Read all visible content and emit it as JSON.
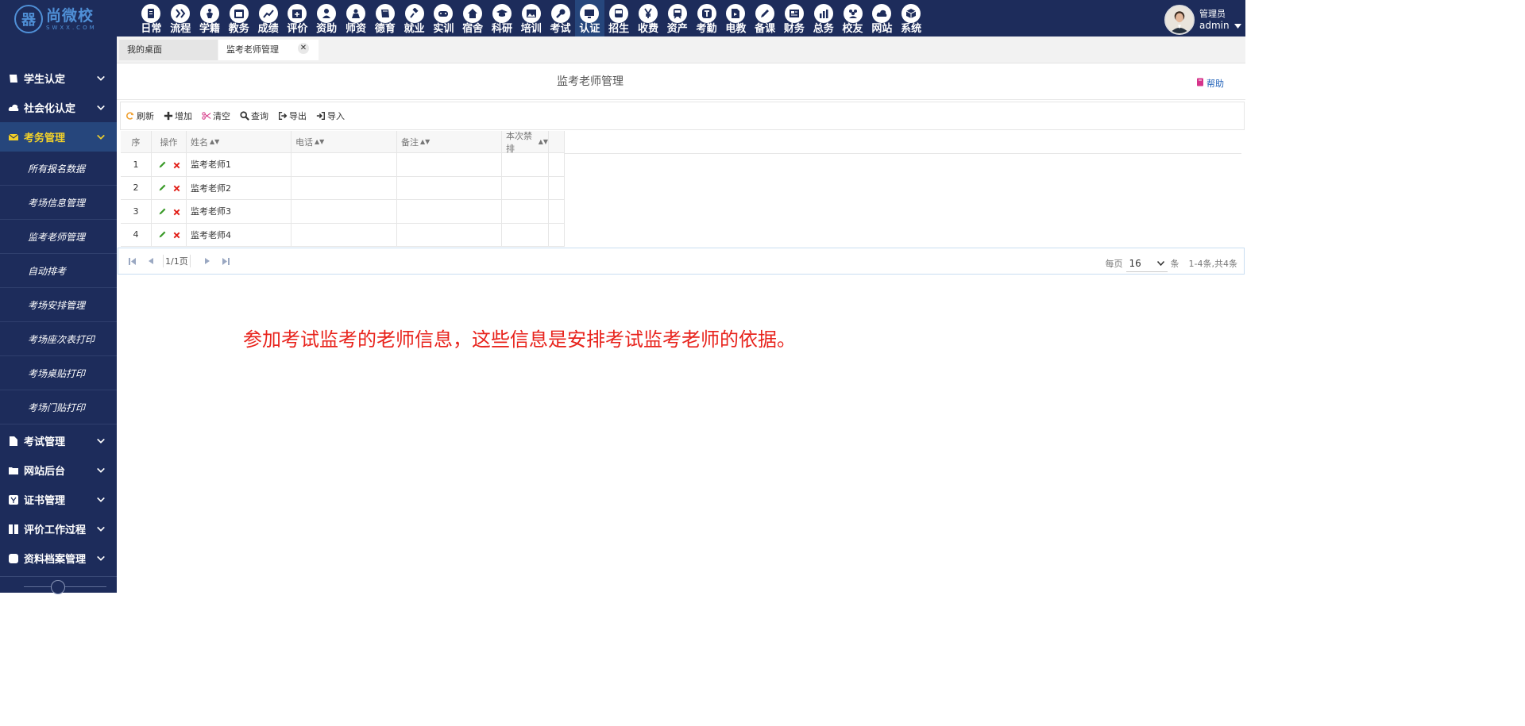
{
  "brand": {
    "name": "尚微校",
    "sub": "SWXX.COM",
    "mark": "器"
  },
  "modules": [
    {
      "label": "日常",
      "icon": "document-icon"
    },
    {
      "label": "流程",
      "icon": "workflow-icon"
    },
    {
      "label": "学籍",
      "icon": "student-icon"
    },
    {
      "label": "教务",
      "icon": "calendar-icon"
    },
    {
      "label": "成绩",
      "icon": "chart-icon"
    },
    {
      "label": "评价",
      "icon": "calendar-plus-icon"
    },
    {
      "label": "资助",
      "icon": "user-money-icon"
    },
    {
      "label": "师资",
      "icon": "teacher-icon"
    },
    {
      "label": "德育",
      "icon": "book-icon"
    },
    {
      "label": "就业",
      "icon": "gavel-icon"
    },
    {
      "label": "实训",
      "icon": "gamepad-icon"
    },
    {
      "label": "宿舍",
      "icon": "home-icon"
    },
    {
      "label": "科研",
      "icon": "graduation-cap-icon"
    },
    {
      "label": "培训",
      "icon": "image-icon"
    },
    {
      "label": "考试",
      "icon": "wrench-icon"
    },
    {
      "label": "认证",
      "icon": "monitor-icon",
      "active": true
    },
    {
      "label": "招生",
      "icon": "bus-icon"
    },
    {
      "label": "收费",
      "icon": "yen-icon"
    },
    {
      "label": "资产",
      "icon": "train-icon"
    },
    {
      "label": "考勤",
      "icon": "t-icon"
    },
    {
      "label": "电教",
      "icon": "media-file-icon"
    },
    {
      "label": "备课",
      "icon": "edit-icon"
    },
    {
      "label": "财务",
      "icon": "newspaper-icon"
    },
    {
      "label": "总务",
      "icon": "bar-chart-icon"
    },
    {
      "label": "校友",
      "icon": "group-icon"
    },
    {
      "label": "网站",
      "icon": "cloud-icon"
    },
    {
      "label": "系统",
      "icon": "cube-icon"
    }
  ],
  "user": {
    "role": "管理员",
    "name": "admin"
  },
  "sidebar": {
    "groups_top": [
      {
        "label": "学生认定",
        "icon": "book-icon"
      },
      {
        "label": "社会化认定",
        "icon": "cloud-icon"
      },
      {
        "label": "考务管理",
        "icon": "envelope-icon",
        "active": true
      }
    ],
    "sub_items": [
      "所有报名数据",
      "考场信息管理",
      "监考老师管理",
      "自动排考",
      "考场安排管理",
      "考场座次表打印",
      "考场桌贴打印",
      "考场门贴打印"
    ],
    "groups_bottom": [
      {
        "label": "考试管理",
        "icon": "file-icon"
      },
      {
        "label": "网站后台",
        "icon": "folder-icon"
      },
      {
        "label": "证书管理",
        "icon": "certificate-icon"
      },
      {
        "label": "评价工作过程",
        "icon": "columns-icon"
      },
      {
        "label": "资料档案管理",
        "icon": "square-icon"
      }
    ]
  },
  "tabs": {
    "home": "我的桌面",
    "current": "监考老师管理"
  },
  "page": {
    "title": "监考老师管理",
    "help": "帮助"
  },
  "toolbar": [
    {
      "label": "刷新",
      "icon": "refresh-icon",
      "color": "#f0a030"
    },
    {
      "label": "增加",
      "icon": "plus-icon",
      "color": "#333333"
    },
    {
      "label": "清空",
      "icon": "scissors-icon",
      "color": "#d63c8a"
    },
    {
      "label": "查询",
      "icon": "search-icon",
      "color": "#333333"
    },
    {
      "label": "导出",
      "icon": "export-icon",
      "color": "#333333"
    },
    {
      "label": "导入",
      "icon": "import-icon",
      "color": "#333333"
    }
  ],
  "table": {
    "headers": {
      "no": "序",
      "op": "操作",
      "name": "姓名",
      "phone": "电话",
      "note": "备注",
      "once": "本次禁排"
    },
    "rows": [
      {
        "no": "1",
        "name": "监考老师1",
        "phone": "",
        "note": "",
        "once": ""
      },
      {
        "no": "2",
        "name": "监考老师2",
        "phone": "",
        "note": "",
        "once": ""
      },
      {
        "no": "3",
        "name": "监考老师3",
        "phone": "",
        "note": "",
        "once": ""
      },
      {
        "no": "4",
        "name": "监考老师4",
        "phone": "",
        "note": "",
        "once": ""
      }
    ]
  },
  "pager": {
    "page": "1/1页",
    "per_page_label": "每页",
    "per_page_value": "16",
    "unit": "条",
    "summary": "1-4条,共4条"
  },
  "annotation": "参加考试监考的老师信息，这些信息是安排考试监考老师的依据。",
  "colors": {
    "nav_bg": "#1d2c5b",
    "active_bg": "#26467c",
    "active_text": "#f2d129",
    "annotation": "#e8231c",
    "edit": "#3a9a28",
    "delete": "#e2221b"
  }
}
